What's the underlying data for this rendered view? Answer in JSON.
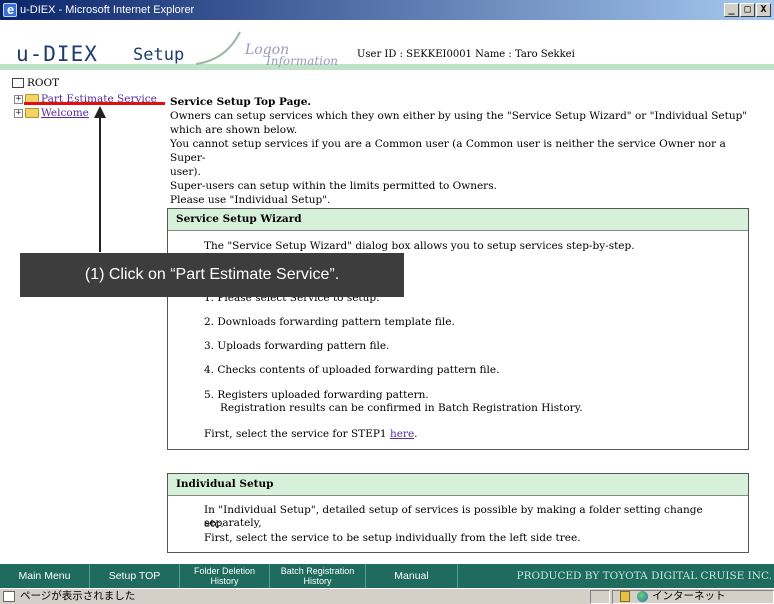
{
  "window": {
    "title": "u-DIEX - Microsoft Internet Explorer",
    "buttons": [
      "_",
      "□",
      "X"
    ]
  },
  "header": {
    "brand": "u-DIEX",
    "section": "Setup",
    "logon_1": "Logon",
    "logon_2": "Information",
    "user_info": "User ID : SEKKEI0001    Name : Taro Sekkei"
  },
  "tree": {
    "root": "ROOT",
    "items": [
      {
        "label": "Part Estimate Service"
      },
      {
        "label": "Welcome"
      }
    ]
  },
  "main": {
    "title": "Service Setup Top Page.",
    "lines": [
      "Owners can setup services which they own either by using the \"Service Setup Wizard\" or \"Individual Setup\"",
      "which are shown below.",
      "You cannot setup services if you are a Common user (a Common user is neither the service Owner nor a Super-",
      "user).",
      "Super-users can setup within the limits permitted to Owners.",
      "Please use \"Individual Setup\"."
    ]
  },
  "wizard": {
    "heading": "Service Setup Wizard",
    "intro": "The \"Service Setup Wizard\" dialog box allows you to setup services step-by-step.",
    "step1": "1. Please select Service to setup.",
    "step2": "2. Downloads forwarding pattern template file.",
    "step3": "3. Uploads forwarding pattern file.",
    "step4": "4. Checks contents of uploaded forwarding pattern file.",
    "step5a": "5. Registers uploaded forwarding pattern.",
    "step5b": "Registration results can be confirmed in Batch Registration History.",
    "first_prefix": "First, select the service for STEP1 ",
    "first_link": "here",
    "first_suffix": "."
  },
  "individual": {
    "heading": "Individual Setup",
    "line1": "In \"Individual Setup\", detailed setup of services is possible by making a folder setting change separately,",
    "line2": "etc.",
    "line3": "First, select the service to be setup individually from the left side tree."
  },
  "callout": {
    "text": "(1) Click on “Part Estimate Service”."
  },
  "bottom_nav": {
    "main_menu": "Main Menu",
    "setup_top": "Setup TOP",
    "folder_deletion_1": "Folder Deletion",
    "folder_deletion_2": "History",
    "batch_registration_1": "Batch Registration",
    "batch_registration_2": "History",
    "manual": "Manual",
    "produced_by": "PRODUCED BY TOYOTA DIGITAL CRUISE INC."
  },
  "status_bar": {
    "text": "ページが表示されました",
    "zone": "インターネット"
  },
  "colors": {
    "nav_bg": "#1f6b5e",
    "box_header": "#d7f0da",
    "highlight_line": "#e01010",
    "callout_bg": "#3d3d3d"
  }
}
